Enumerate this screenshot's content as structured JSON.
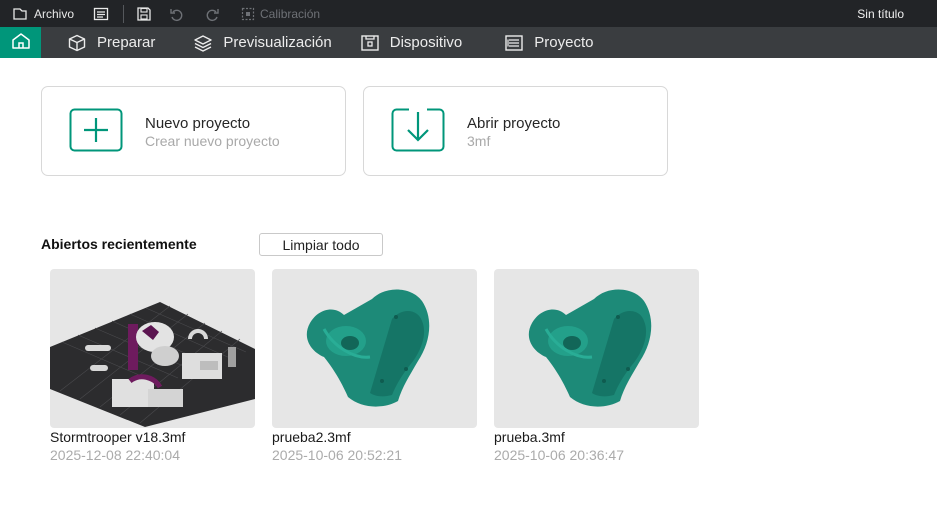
{
  "titlebar": {
    "file_label": "Archivo",
    "calibration_label": "Calibración",
    "document_title": "Sin título"
  },
  "nav": {
    "tabs": [
      {
        "label": "Preparar",
        "icon": "cube-icon"
      },
      {
        "label": "Previsualización",
        "icon": "layers-icon"
      },
      {
        "label": "Dispositivo",
        "icon": "device-icon"
      },
      {
        "label": "Proyecto",
        "icon": "project-list-icon"
      }
    ]
  },
  "cards": {
    "new": {
      "title": "Nuevo proyecto",
      "subtitle": "Crear nuevo proyecto",
      "icon": "plus-square-icon"
    },
    "open": {
      "title": "Abrir proyecto",
      "subtitle": "3mf",
      "icon": "download-arrow-icon"
    }
  },
  "recent": {
    "heading": "Abiertos recientemente",
    "clear_label": "Limpiar todo",
    "items": [
      {
        "name": "Stormtrooper v18.3mf",
        "date": "2025-12-08 22:40:04"
      },
      {
        "name": "prueba2.3mf",
        "date": "2025-10-06 20:52:21"
      },
      {
        "name": "prueba.3mf",
        "date": "2025-10-06 20:36:47"
      }
    ]
  },
  "colors": {
    "accent": "#00967a",
    "titlebar_bg": "#222427",
    "navbar_bg": "#3a3d40",
    "model_teal": "#1d8a78"
  }
}
